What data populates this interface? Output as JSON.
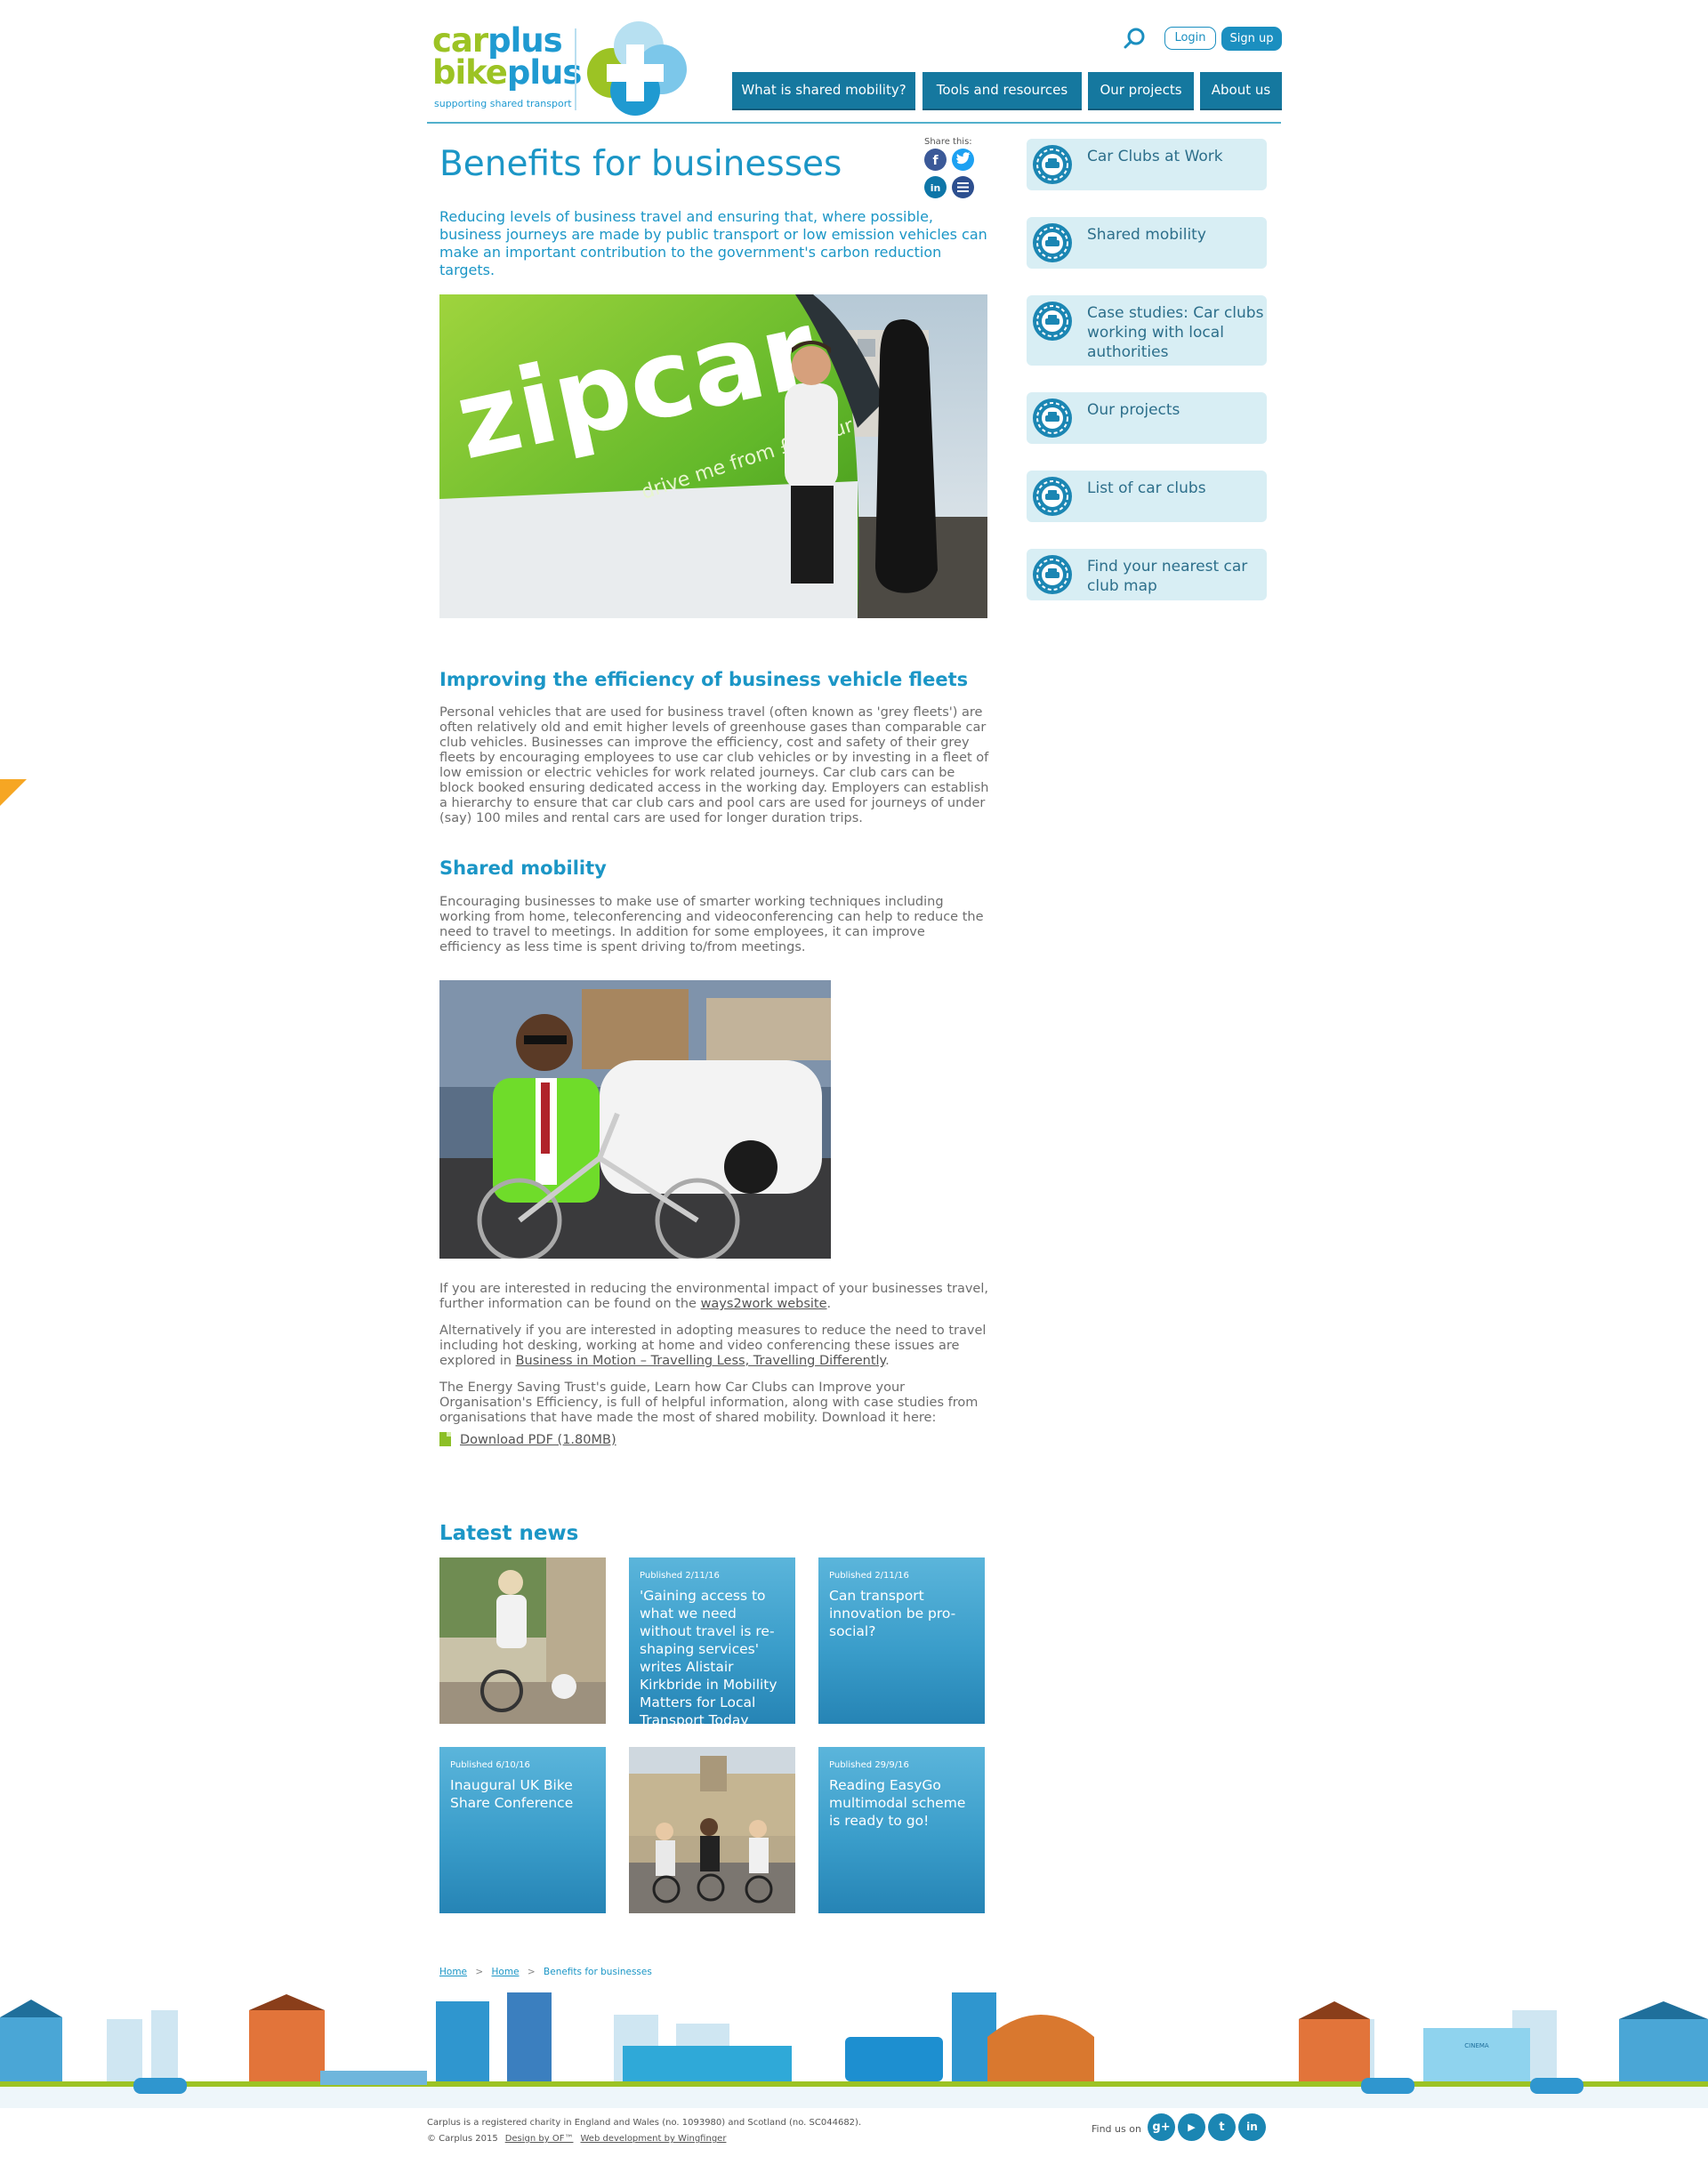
{
  "header": {
    "logo_word1a": "car",
    "logo_word1b": "plus",
    "logo_word2a": "bike",
    "logo_word2b": "plus",
    "logo_tagline": "supporting shared transport",
    "login_label": "Login",
    "signup_label": "Sign up",
    "nav": [
      "What is shared mobility?",
      "Tools and resources",
      "Our projects",
      "About us"
    ]
  },
  "main": {
    "title": "Benefits for businesses",
    "share_label": "Share this:",
    "intro": "Reducing levels of business travel and ensuring that, where possible, business journeys are made by public transport or low emission vehicles can make an important contribution to the government's carbon reduction targets.",
    "photo1_van_text": "zipcar",
    "photo1_van_subtext": "drive me from £9/hour",
    "section1_heading": "Improving the efficiency of business vehicle fleets",
    "section1_body": "Personal vehicles that are used for business travel (often known as 'grey fleets') are often relatively old and emit higher levels of greenhouse gases than comparable car club vehicles. Businesses can improve the efficiency, cost and safety of their grey fleets by encouraging employees to use car club vehicles or by investing in a fleet of low emission or electric vehicles for work related journeys. Car club cars can be block booked ensuring dedicated access in the working day. Employers can establish a hierarchy to ensure that car club cars and pool cars are used for journeys of under (say) 100 miles and rental cars are used for longer duration trips.",
    "section2_heading": "Shared mobility",
    "section2_body": "Encouraging businesses to make use of smarter working techniques including working from home, teleconferencing and videoconferencing can help to reduce the need to travel to meetings. In addition for some employees, it can improve efficiency as less time is spent driving to/from meetings.",
    "para3_text": "If you are interested in reducing the environmental impact of your businesses travel, further information can be found on the ",
    "para3_link": "ways2work website",
    "para3_end": ".",
    "para4_text": "Alternatively if you are interested in adopting measures to reduce the need to travel including hot desking, working at home and video conferencing these issues are explored in ",
    "para4_link": "Business in Motion – Travelling Less, Travelling Differently",
    "para4_end": ".",
    "para5_text": "The Energy Saving Trust's guide, Learn how Car Clubs can Improve your Organisation's Efficiency, is full of helpful information, along with case studies from organisations that have made the most of shared mobility. Download it here:",
    "download_label": "Download PDF (1.80MB)"
  },
  "sidebar": {
    "items": [
      "Car Clubs at Work",
      "Shared mobility",
      "Case studies: Car clubs working with local authorities",
      "Our projects",
      "List of car clubs",
      "Find your nearest car club map"
    ]
  },
  "news": {
    "title": "Latest news",
    "items": [
      {
        "date": "Published 2/11/16",
        "headline": "'Gaining access to what we need without travel is re-shaping services' writes Alistair Kirkbride in Mobility Matters for Local Transport Today"
      },
      {
        "date": "Published 2/11/16",
        "headline": "Can transport innovation be pro-social?"
      },
      {
        "date": "Published 6/10/16",
        "headline": "Inaugural UK Bike Share Conference"
      },
      {
        "date": "Published 29/9/16",
        "headline": "Reading EasyGo multimodal scheme is ready to go!"
      }
    ]
  },
  "breadcrumb": {
    "items": [
      "Home",
      "Home",
      "Benefits for businesses"
    ],
    "separator": ">"
  },
  "street_signs": {
    "cinema": "CINEMA"
  },
  "footer": {
    "charity_line": "Carplus is a registered charity in England and Wales (no. 1093980) and Scotland (no. SC044682).",
    "copyright": "© Carplus 2015",
    "design_link": "Design by OF™",
    "dev_link": "Web development by Wingfinger",
    "find_us": "Find us on",
    "social": [
      "g+",
      "▶",
      "t",
      "in"
    ]
  },
  "colors": {
    "brand_blue": "#1b96c6",
    "nav_blue": "#15789f",
    "lime": "#9cc324",
    "sidebar_bg": "#d8eef4"
  }
}
